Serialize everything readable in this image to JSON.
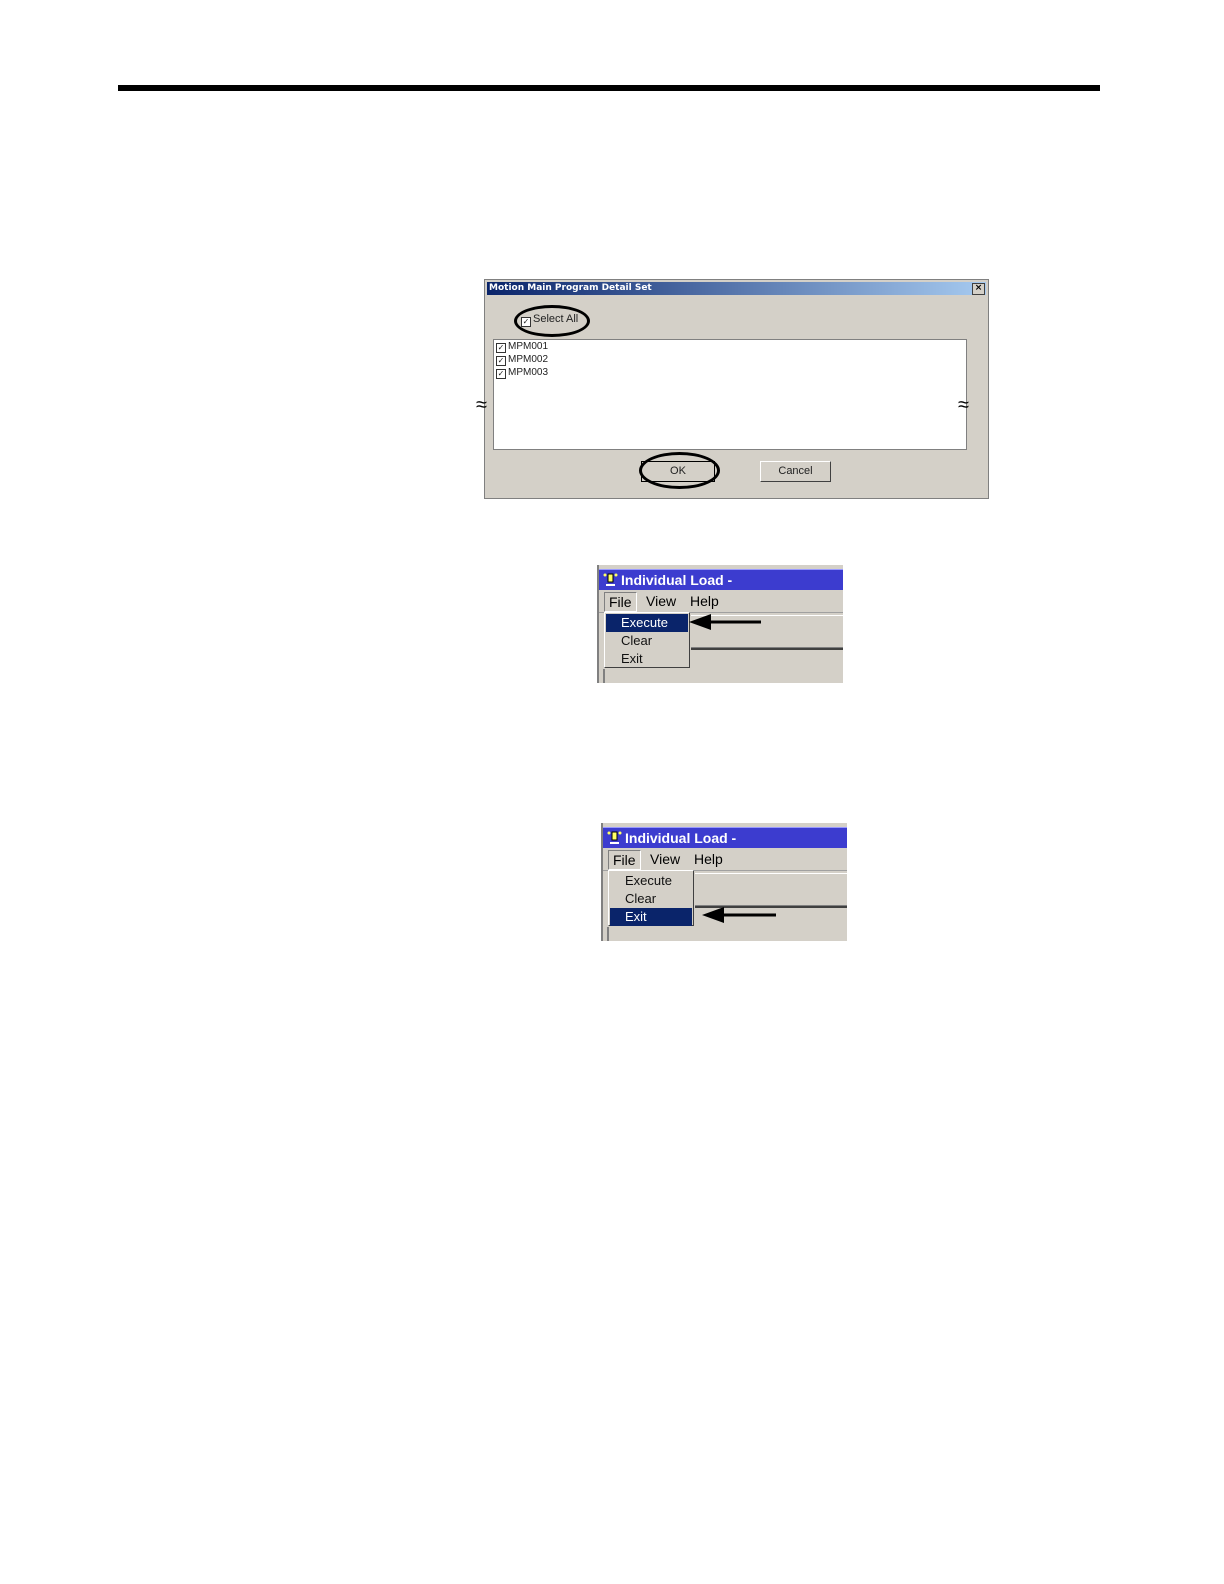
{
  "dialog": {
    "title": "Motion Main Program Detail Set",
    "close_label": "×",
    "select_all_label": "Select All",
    "select_all_checked": true,
    "programs": [
      {
        "name": "MPM001",
        "checked": true
      },
      {
        "name": "MPM002",
        "checked": true
      },
      {
        "name": "MPM003",
        "checked": true
      }
    ],
    "ok_label": "OK",
    "cancel_label": "Cancel",
    "break_mark": "≈"
  },
  "windows": [
    {
      "title": "Individual Load -",
      "menu": [
        "File",
        "View",
        "Help"
      ],
      "file_menu_items": [
        "Execute",
        "Clear",
        "Exit"
      ],
      "selected_item": "Execute"
    },
    {
      "title": "Individual Load -",
      "menu": [
        "File",
        "View",
        "Help"
      ],
      "file_menu_items": [
        "Execute",
        "Clear",
        "Exit"
      ],
      "selected_item": "Exit"
    }
  ],
  "colors": {
    "dialog_title_start": "#0a246a",
    "window_title": "#3c3ccf",
    "menu_highlight": "#0a246a",
    "face": "#d4d0c8"
  },
  "icons": {
    "close": "close-icon",
    "check": "check-icon",
    "app": "app-icon",
    "arrow": "arrow-left-icon"
  }
}
